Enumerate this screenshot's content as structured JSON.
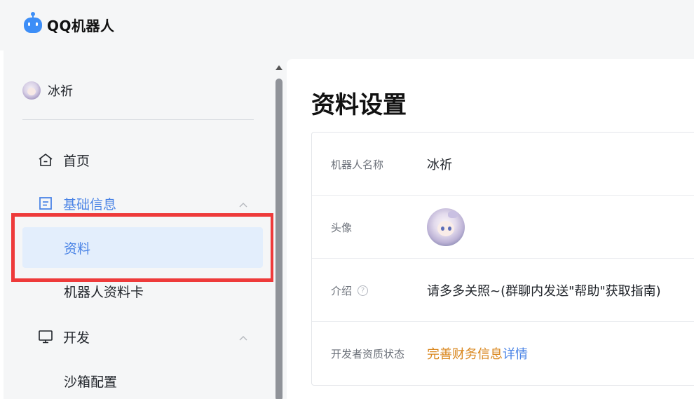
{
  "app": {
    "title": "QQ机器人"
  },
  "sidebar": {
    "user_name": "冰祈",
    "items": [
      {
        "label": "首页",
        "icon": "home-icon"
      },
      {
        "label": "基础信息",
        "icon": "document-icon",
        "expanded": true,
        "active": true
      },
      {
        "label": "资料",
        "selected": true
      },
      {
        "label": "机器人资料卡"
      },
      {
        "label": "开发",
        "icon": "monitor-icon",
        "expanded": true
      },
      {
        "label": "沙箱配置"
      }
    ]
  },
  "main": {
    "title": "资料设置",
    "rows": [
      {
        "label": "机器人名称",
        "value": "冰祈"
      },
      {
        "label": "头像"
      },
      {
        "label": "介绍",
        "help": "?",
        "value": "请多多关照~(群聊内发送\"帮助\"获取指南)"
      },
      {
        "label": "开发者资质状态",
        "link_orange": "完善财务信息",
        "link_blue": "详情"
      }
    ]
  },
  "colors": {
    "accent": "#4b84e6",
    "highlight": "#ee3a3a",
    "warning_link": "#d9861c",
    "selected_bg": "#e3eefc"
  }
}
